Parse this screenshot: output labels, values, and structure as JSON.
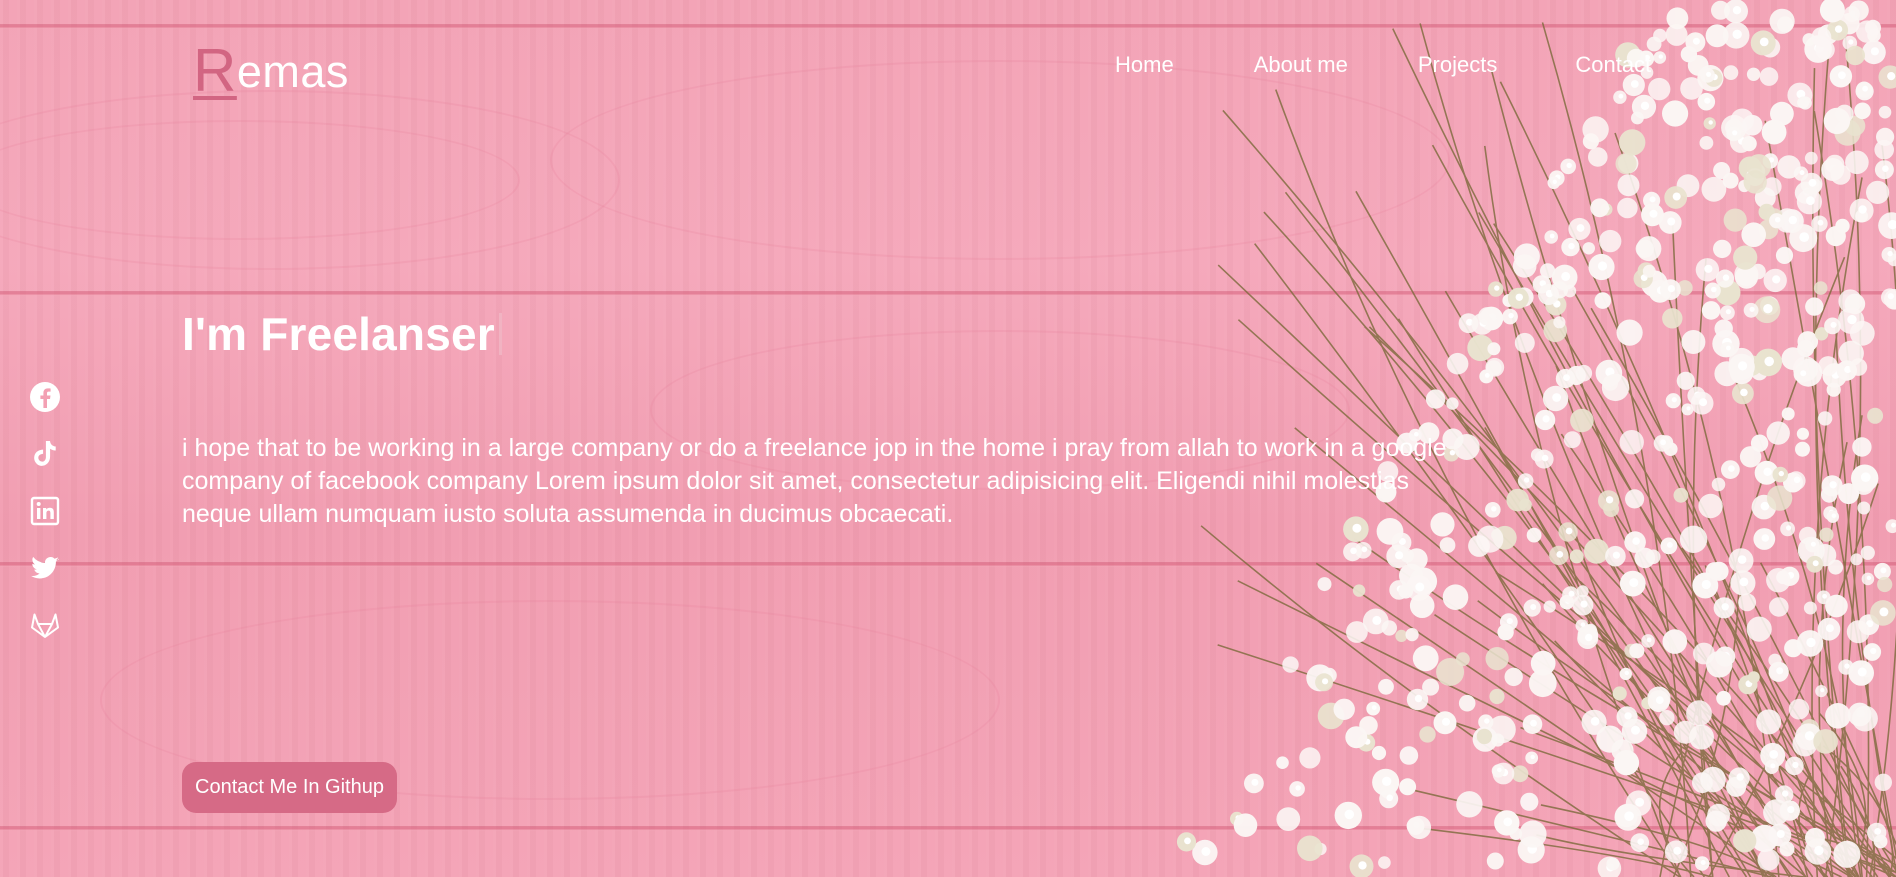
{
  "brand": {
    "first_letter": "R",
    "rest": "emas"
  },
  "nav": {
    "items": [
      "Home",
      "About me",
      "Projects",
      "Contact"
    ]
  },
  "social": [
    "facebook-icon",
    "tiktok-icon",
    "linkedin-icon",
    "twitter-icon",
    "gitlab-icon"
  ],
  "hero": {
    "title": "I'm Freelanser",
    "text": "i hope that to be working in a large company or do a freelance jop in the home i pray from allah to work in a google company of facebook company Lorem ipsum dolor sit amet, consectetur adipisicing elit. Eligendi nihil molestias neque ullam numquam iusto soluta assumenda in ducimus obcaecati.",
    "cta_label": "Contact Me In Githup"
  },
  "colors": {
    "background": "#f4a0b3",
    "accent": "#d26582",
    "button": "#d66a86",
    "text": "#ffffff"
  }
}
